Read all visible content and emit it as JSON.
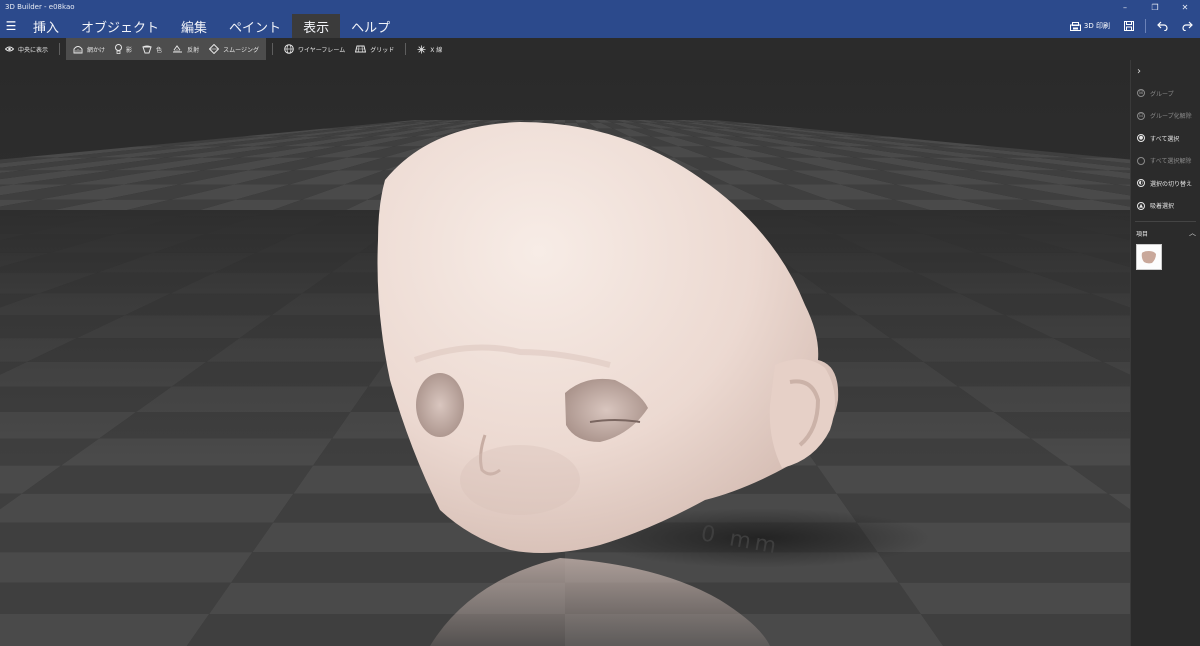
{
  "window": {
    "title": "3D Builder - e08kao",
    "controls": [
      "–",
      "❐",
      "✕"
    ]
  },
  "menu": {
    "tabs": [
      {
        "label": "挿入",
        "active": false
      },
      {
        "label": "オブジェクト",
        "active": false
      },
      {
        "label": "編集",
        "active": false
      },
      {
        "label": "ペイント",
        "active": false
      },
      {
        "label": "表示",
        "active": true
      },
      {
        "label": "ヘルプ",
        "active": false
      }
    ],
    "print_label": "3D 印刷"
  },
  "toolbar": {
    "center_view": "中央に表示",
    "shading": "網かけ",
    "shadow": "影",
    "color": "色",
    "reflection": "反射",
    "smoothing": "スムージング",
    "wireframe": "ワイヤーフレーム",
    "grid": "グリッド",
    "axis": "X 線"
  },
  "panel": {
    "items": [
      {
        "label": "グループ",
        "enabled": false
      },
      {
        "label": "グループ化解除",
        "enabled": false
      },
      {
        "label": "すべて選択",
        "enabled": true
      },
      {
        "label": "すべて選択解除",
        "enabled": false
      },
      {
        "label": "選択の切り替え",
        "enabled": true
      },
      {
        "label": "吸着選択",
        "enabled": true
      }
    ],
    "section_title": "項目"
  },
  "scene": {
    "floor_label": "0 mm",
    "model_color": "#ecd9d1"
  },
  "colors": {
    "accent": "#2c4a8c",
    "active_tab": "#3b3b3b",
    "toolbar_group": "#4d4d4d"
  }
}
